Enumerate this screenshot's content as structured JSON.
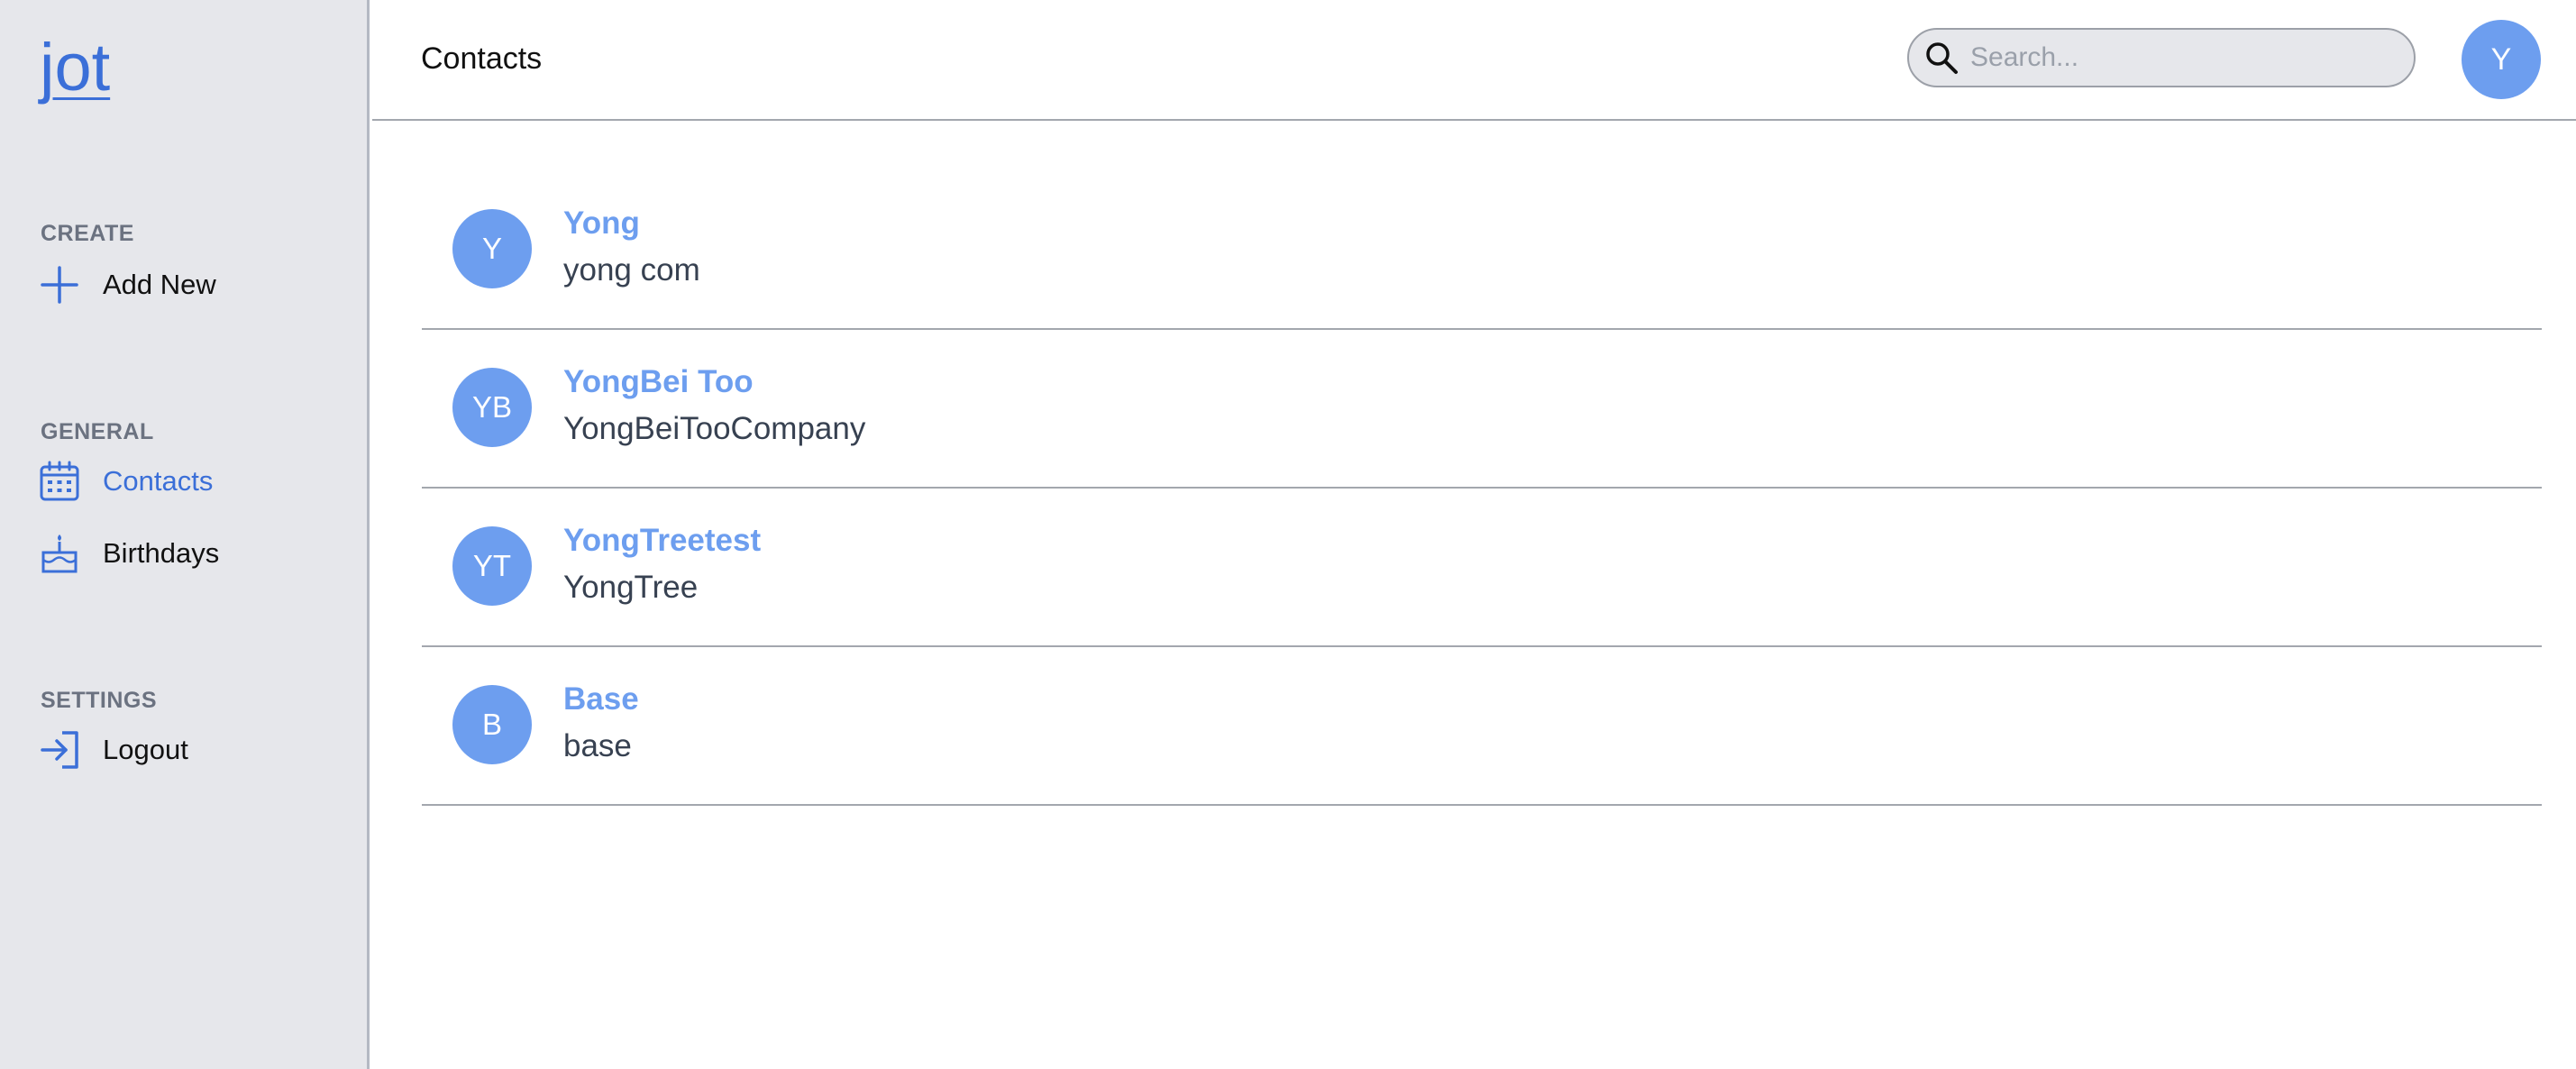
{
  "app": {
    "logo": "jot",
    "accent_color": "#3b6fd8",
    "avatar_color": "#6d9eef"
  },
  "sidebar": {
    "sections": [
      {
        "label": "CREATE",
        "items": [
          {
            "label": "Add New",
            "icon": "plus-icon",
            "active": false
          }
        ]
      },
      {
        "label": "GENERAL",
        "items": [
          {
            "label": "Contacts",
            "icon": "calendar-icon",
            "active": true
          },
          {
            "label": "Birthdays",
            "icon": "cake-icon",
            "active": false
          }
        ]
      },
      {
        "label": "SETTINGS",
        "items": [
          {
            "label": "Logout",
            "icon": "logout-icon",
            "active": false
          }
        ]
      }
    ]
  },
  "header": {
    "title": "Contacts",
    "search_placeholder": "Search...",
    "search_value": "",
    "user_initial": "Y"
  },
  "contacts": [
    {
      "initials": "Y",
      "name": "Yong",
      "company": "yong com"
    },
    {
      "initials": "YB",
      "name": "YongBei Too",
      "company": "YongBeiTooCompany"
    },
    {
      "initials": "YT",
      "name": "YongTreetest",
      "company": "YongTree"
    },
    {
      "initials": "B",
      "name": "Base",
      "company": "base"
    }
  ]
}
